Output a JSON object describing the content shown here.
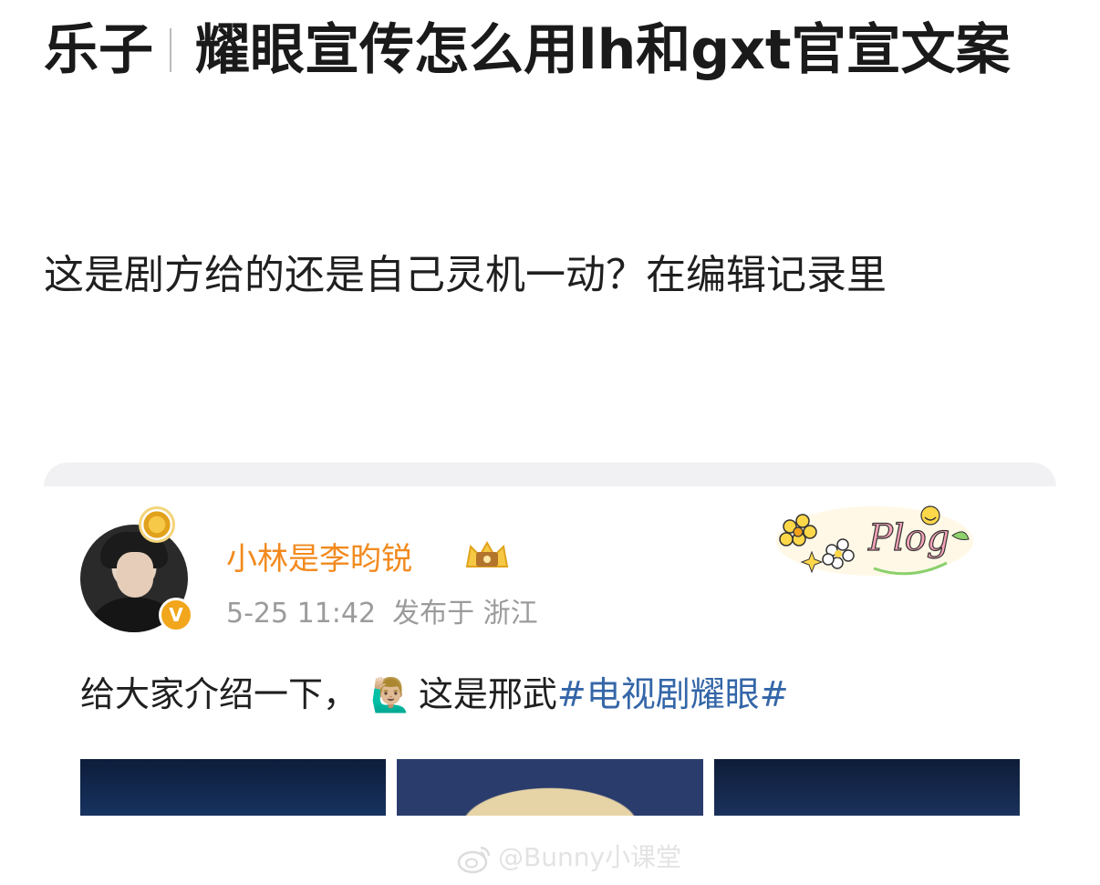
{
  "post": {
    "title_category": "乐子",
    "title_text": "耀眼宣传怎么用lh和gxt官宣文案",
    "body": "这是剧方给的还是自己灵机一动？在编辑记录里"
  },
  "embedded_post": {
    "user_name": "小林是李昀锐",
    "verified_badge": "V",
    "timestamp": "5-25 11:42",
    "location_label": "发布于 浙江",
    "text_before_emoji": "给大家介绍一下，",
    "emoji": "🙋🏼‍♂️",
    "text_after_emoji": "这是邢武",
    "hashtag": "#电视剧耀眼#",
    "sticker_text": "Plog"
  },
  "watermark": {
    "text": "@Bunny小课堂"
  }
}
